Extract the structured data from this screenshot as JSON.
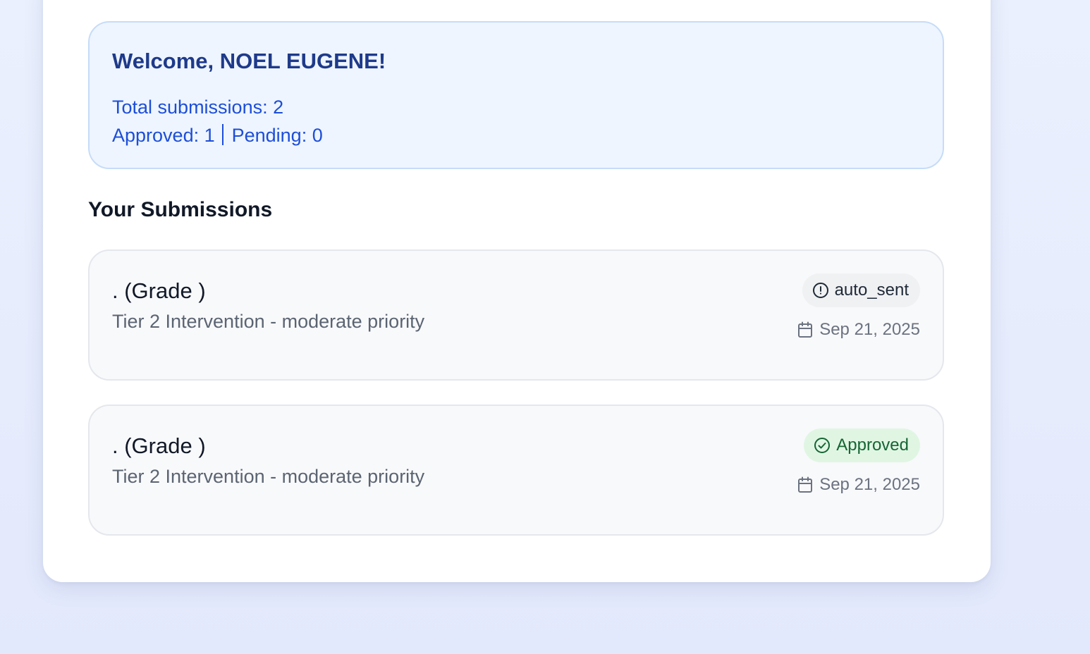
{
  "welcome": {
    "title": "Welcome, NOEL EUGENE!",
    "total_label": "Total submissions: 2",
    "approved_label": "Approved: 1",
    "pending_label": "Pending: 0"
  },
  "submissions_section": {
    "title": "Your Submissions",
    "items": [
      {
        "title": ". (Grade )",
        "description": "Tier 2 Intervention - moderate priority",
        "status": "auto_sent",
        "status_icon": "alert-circle-icon",
        "date": "Sep 21, 2025"
      },
      {
        "title": ". (Grade )",
        "description": "Tier 2 Intervention - moderate priority",
        "status": "Approved",
        "status_icon": "check-circle-icon",
        "date": "Sep 21, 2025"
      }
    ]
  },
  "colors": {
    "accent": "#1d4ed8",
    "heading": "#1e3a8a",
    "approved_bg": "#e0f6e3",
    "approved_text": "#166534"
  }
}
